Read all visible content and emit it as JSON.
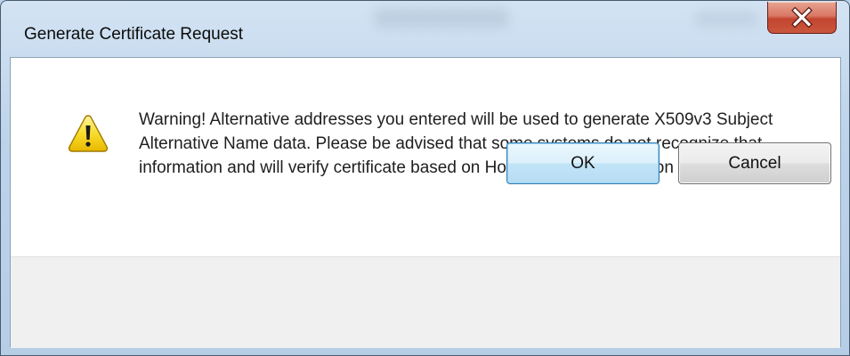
{
  "window": {
    "title": "Generate Certificate Request",
    "close_icon": "close-icon"
  },
  "dialog": {
    "icon": "warning-icon",
    "message": "Warning! Alternative addresses you entered will be used to generate X509v3 Subject Alternative Name data. Please be advised that some systems do not recognize that information and will verify certificate based on Host Address information only."
  },
  "buttons": {
    "ok_label": "OK",
    "cancel_label": "Cancel"
  },
  "colors": {
    "accent_ok_border": "#3c7fb1",
    "close_button": "#c3452f",
    "warning_yellow": "#f5d20c"
  }
}
